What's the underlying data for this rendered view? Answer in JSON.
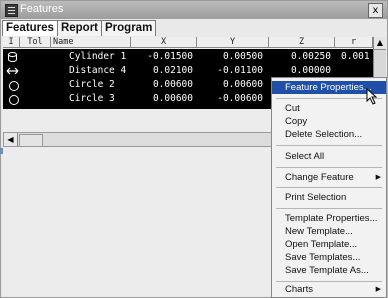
{
  "window": {
    "title": "Features",
    "close_glyph": "x"
  },
  "tabs": [
    {
      "label": "Features"
    },
    {
      "label": "Report"
    },
    {
      "label": "Program"
    }
  ],
  "grid": {
    "columns": [
      "I",
      "Tol",
      "Name",
      "X",
      "Y",
      "Z",
      "r"
    ],
    "rows": [
      {
        "icon": "cylinder-icon",
        "tol": "",
        "name": "Cylinder 1",
        "x": "-0.01500",
        "y": "0.00500",
        "z": "0.00250",
        "r": "0.001"
      },
      {
        "icon": "distance-icon",
        "tol": "",
        "name": "Distance 4",
        "x": "0.02100",
        "y": "-0.01100",
        "z": "0.00000",
        "r": ""
      },
      {
        "icon": "circle-icon",
        "tol": "",
        "name": "Circle 2",
        "x": "0.00600",
        "y": "0.00600",
        "z": "",
        "r": ""
      },
      {
        "icon": "circle-icon",
        "tol": "",
        "name": "Circle 3",
        "x": "0.00600",
        "y": "-0.00600",
        "z": "",
        "r": ""
      }
    ]
  },
  "context_menu": {
    "items": [
      {
        "label": "Feature Properties..."
      },
      {
        "label": "Cut"
      },
      {
        "label": "Copy"
      },
      {
        "label": "Delete Selection..."
      },
      {
        "label": "Select All"
      },
      {
        "label": "Change Feature"
      },
      {
        "label": "Print Selection"
      },
      {
        "label": "Template Properties..."
      },
      {
        "label": "New Template..."
      },
      {
        "label": "Open Template..."
      },
      {
        "label": "Save Templates..."
      },
      {
        "label": "Save Template As..."
      },
      {
        "label": "Charts"
      }
    ],
    "submenu_glyph": "▶"
  }
}
